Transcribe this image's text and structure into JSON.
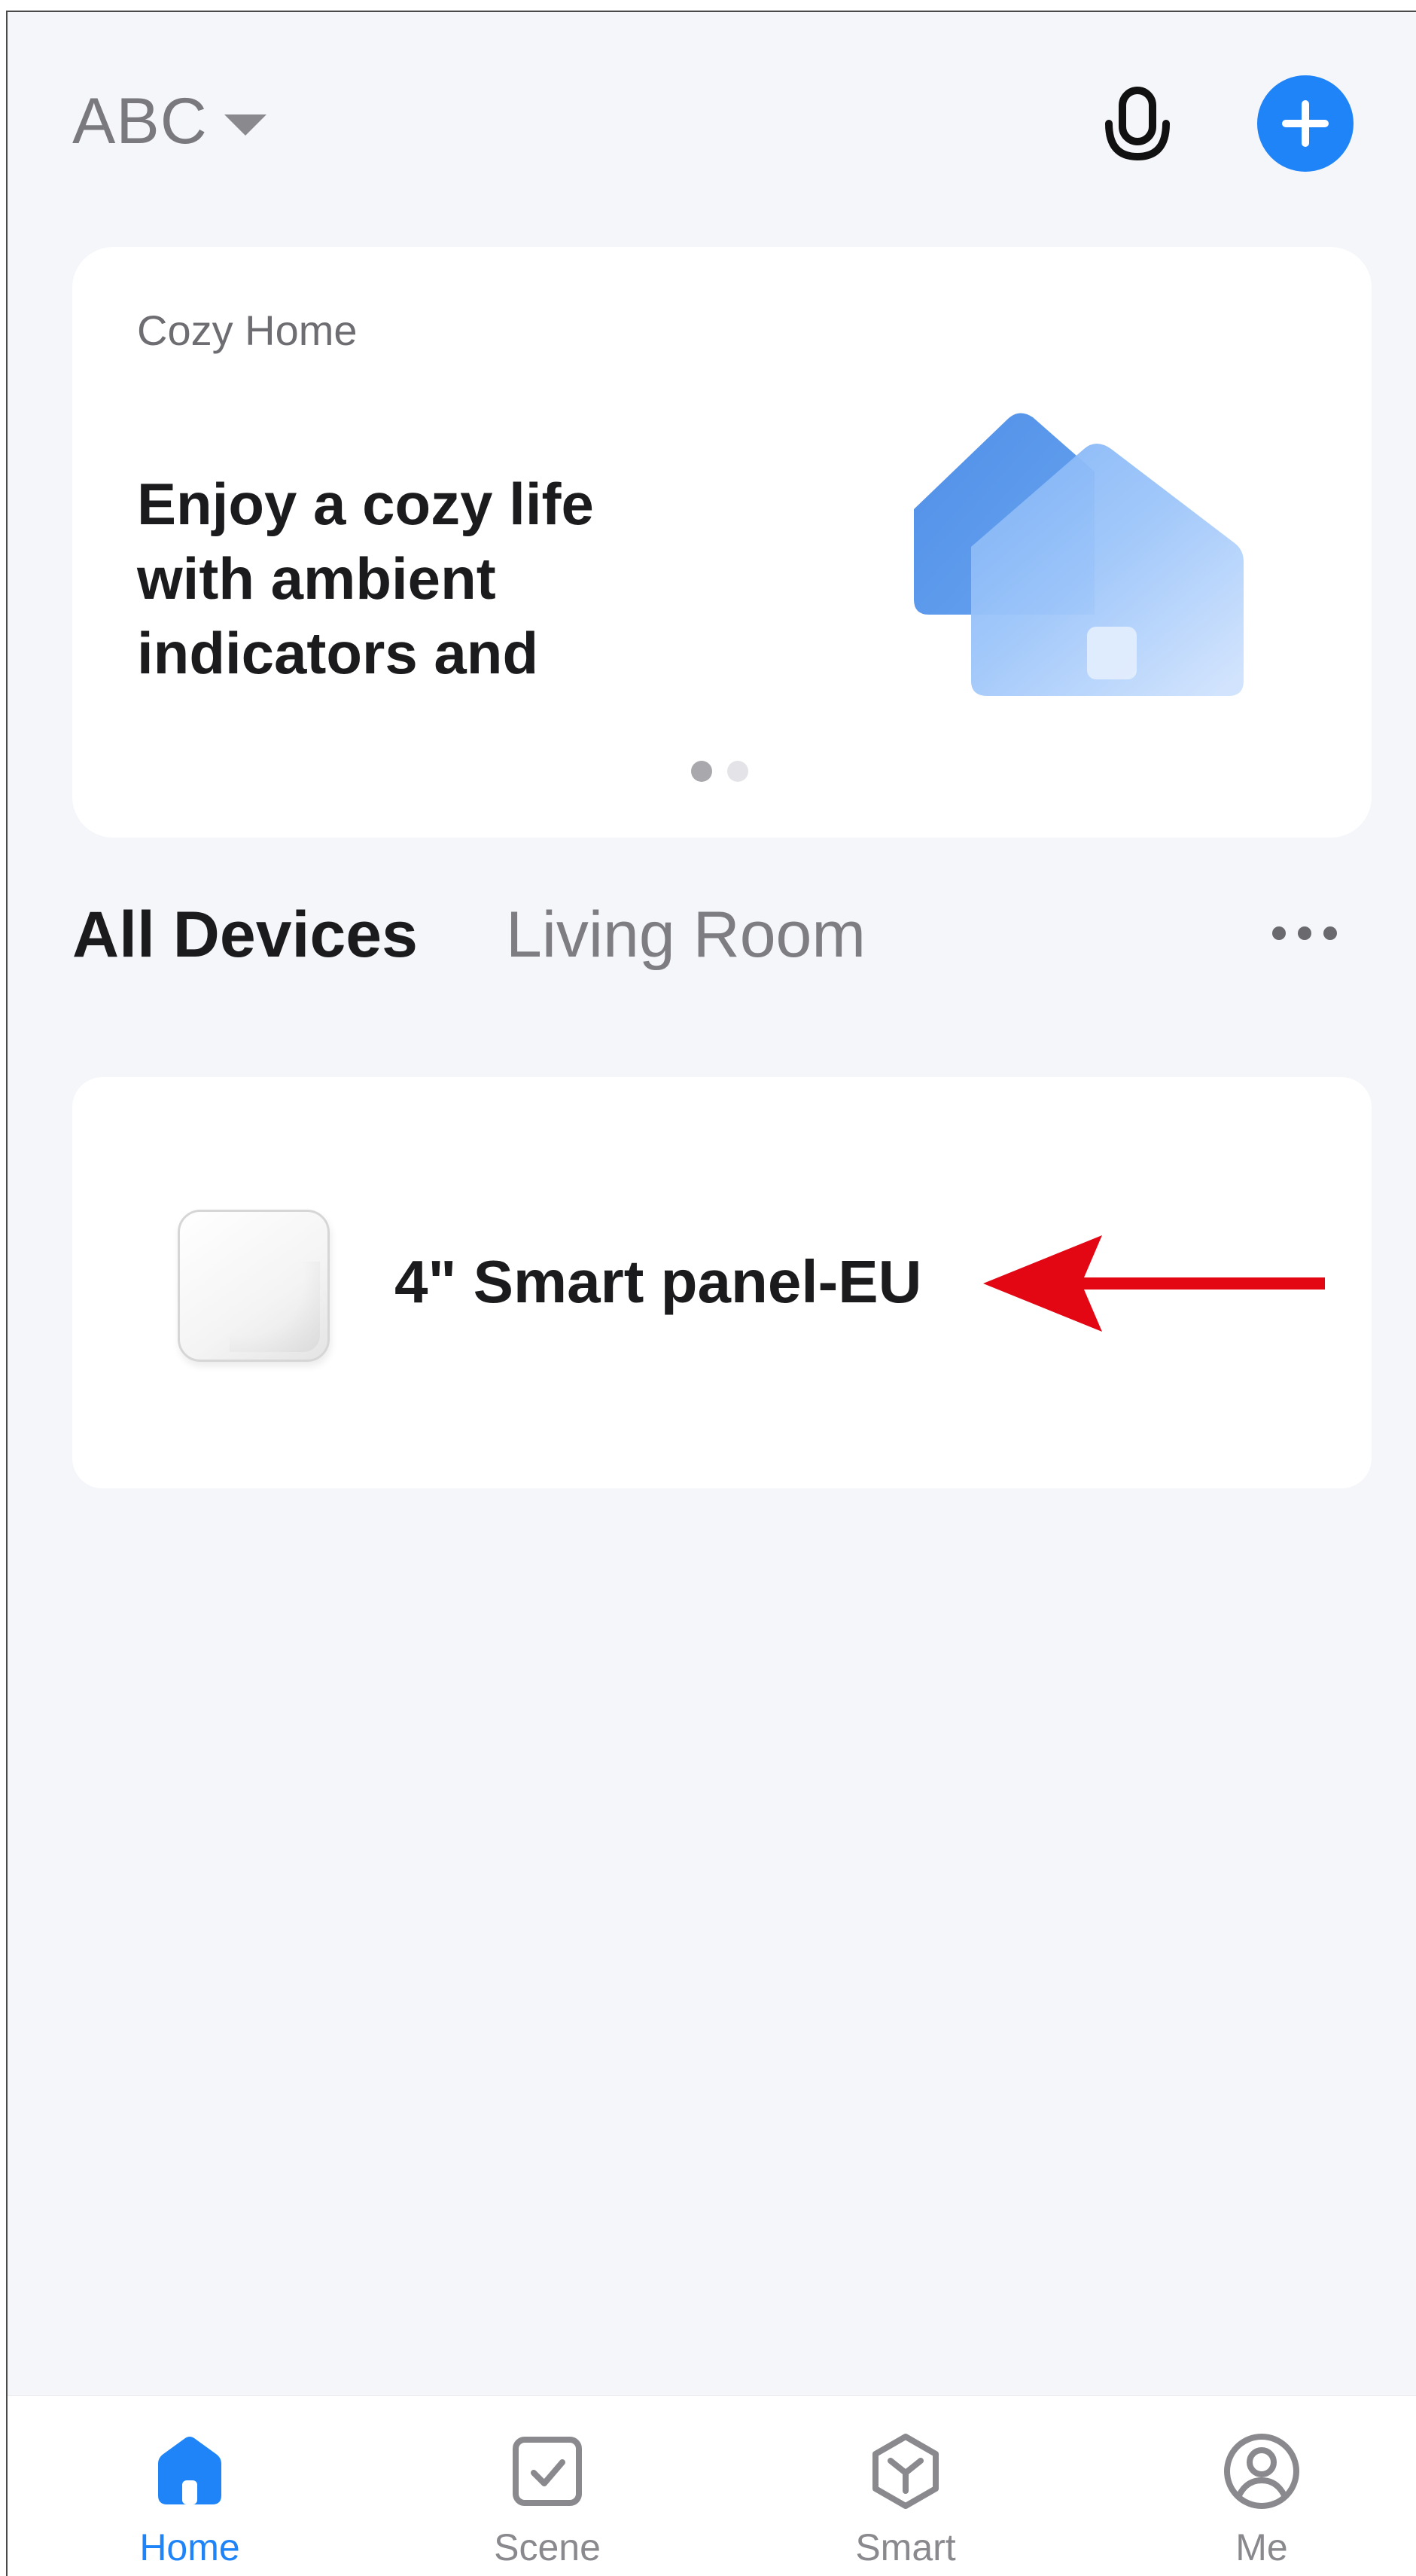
{
  "header": {
    "home_name": "ABC"
  },
  "banner": {
    "subtitle": "Cozy Home",
    "title": "Enjoy a cozy life with ambient indicators and",
    "page_count": 2,
    "active_page": 1
  },
  "tabs": [
    {
      "label": "All Devices",
      "active": true
    },
    {
      "label": "Living Room",
      "active": false
    }
  ],
  "device": {
    "name": "4\" Smart panel-EU"
  },
  "nav": {
    "home": "Home",
    "scene": "Scene",
    "smart": "Smart",
    "me": "Me",
    "active": "Home"
  },
  "colors": {
    "accent": "#1e84f8",
    "annotation_arrow": "#e30613",
    "background": "#f4f6fa"
  }
}
